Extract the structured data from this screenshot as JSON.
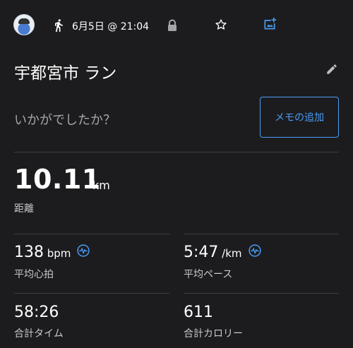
{
  "header": {
    "date_time": "6月5日 @ 21:04",
    "icons": [
      "avatar",
      "running-icon",
      "lock-icon",
      "star-icon",
      "add-photo-icon"
    ]
  },
  "activity": {
    "title": "宇都宮市 ラン",
    "prompt": "いかがでしたか？",
    "memo_button": "メモの追加"
  },
  "distance": {
    "value": "10.11",
    "unit": "km",
    "label": "距離"
  },
  "stats": [
    {
      "value": "138",
      "unit": " bpm",
      "label": "平均心拍",
      "has_chart_icon": true
    },
    {
      "value": "5:47",
      "unit": " /km",
      "label": "平均ペース",
      "has_chart_icon": true
    },
    {
      "value": "58:26",
      "unit": "",
      "label": "合計タイム",
      "has_chart_icon": false
    },
    {
      "value": "611",
      "unit": "",
      "label": "合計カロリー",
      "has_chart_icon": false
    }
  ],
  "colors": {
    "background": "#1c1c1e",
    "accent": "#4b9cf5",
    "divider": "#3d3d40",
    "muted_text": "#a6a6aa"
  }
}
